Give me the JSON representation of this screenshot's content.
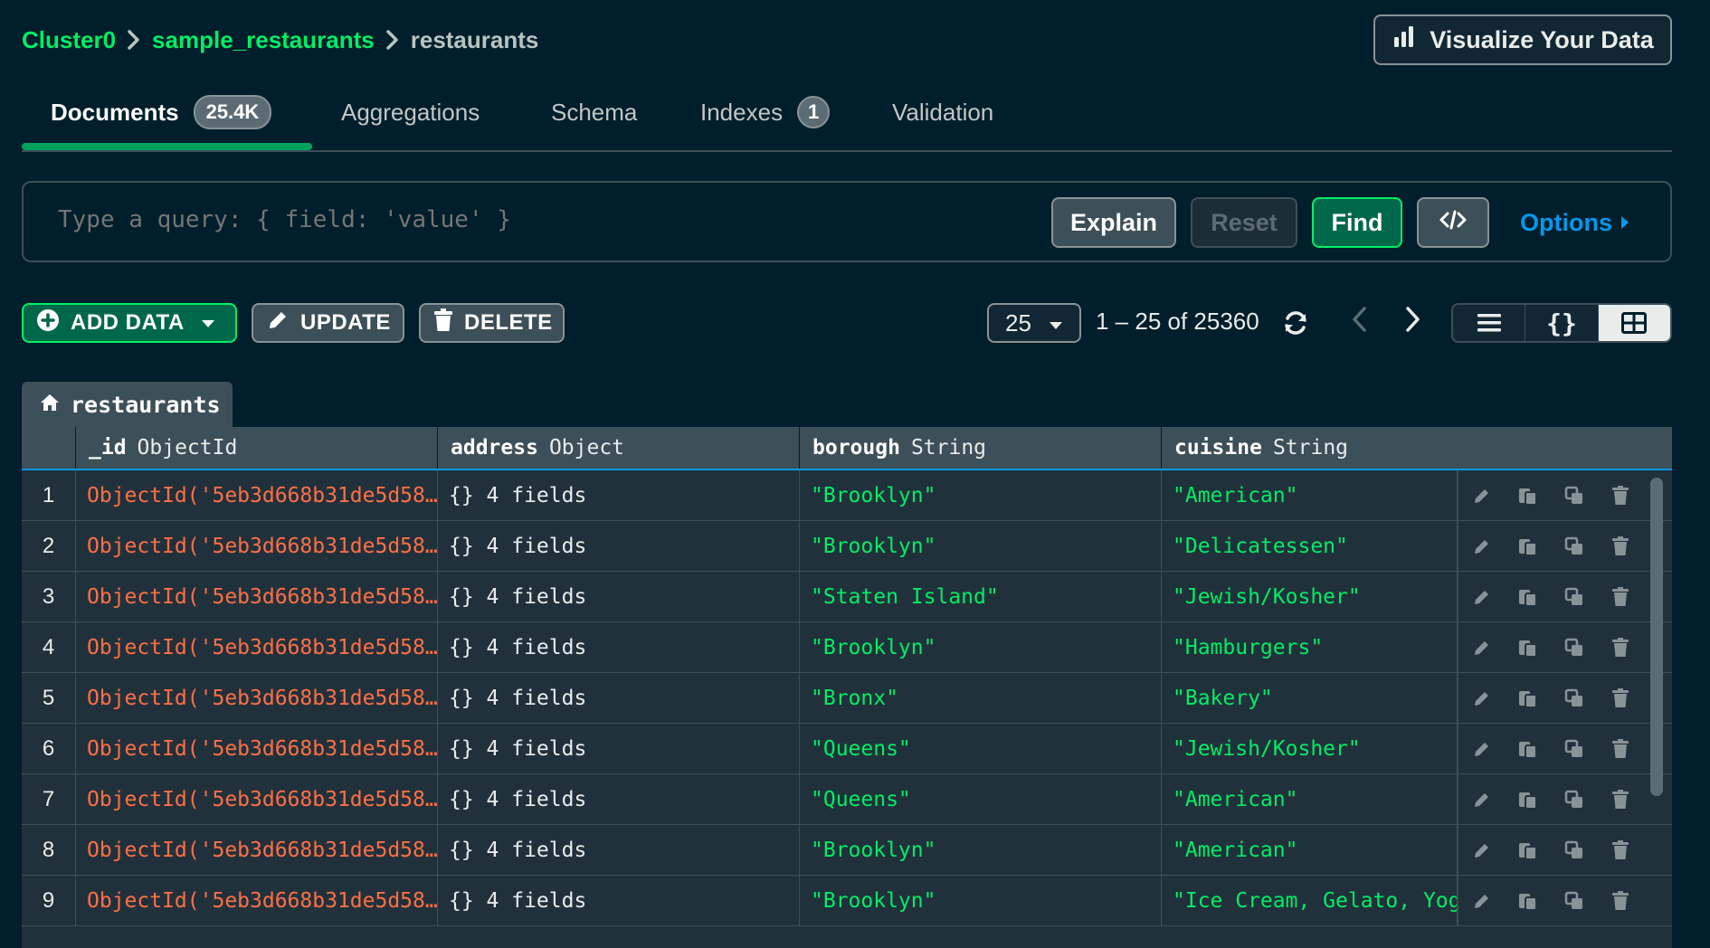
{
  "breadcrumb": {
    "cluster": "Cluster0",
    "database": "sample_restaurants",
    "collection": "restaurants"
  },
  "visualize_button": "Visualize Your Data",
  "tabs": [
    {
      "label": "Documents",
      "badge": "25.4K"
    },
    {
      "label": "Aggregations"
    },
    {
      "label": "Schema"
    },
    {
      "label": "Indexes",
      "badge": "1"
    },
    {
      "label": "Validation"
    }
  ],
  "query": {
    "placeholder": "Type a query: { field: 'value' }",
    "explain": "Explain",
    "reset": "Reset",
    "find": "Find",
    "options": "Options"
  },
  "toolbar": {
    "add_data": "ADD DATA",
    "update": "UPDATE",
    "delete": "DELETE",
    "page_size": "25",
    "range": "1 – 25 of 25360"
  },
  "table": {
    "collection_tab": "restaurants",
    "columns": [
      {
        "name": "_id",
        "type": "ObjectId"
      },
      {
        "name": "address",
        "type": "Object"
      },
      {
        "name": "borough",
        "type": "String"
      },
      {
        "name": "cuisine",
        "type": "String"
      }
    ],
    "rows": [
      {
        "n": "1",
        "id": "ObjectId('5eb3d668b31de5d58…",
        "address": "{} 4 fields",
        "borough": "\"Brooklyn\"",
        "cuisine": "\"American\""
      },
      {
        "n": "2",
        "id": "ObjectId('5eb3d668b31de5d58…",
        "address": "{} 4 fields",
        "borough": "\"Brooklyn\"",
        "cuisine": "\"Delicatessen\""
      },
      {
        "n": "3",
        "id": "ObjectId('5eb3d668b31de5d58…",
        "address": "{} 4 fields",
        "borough": "\"Staten Island\"",
        "cuisine": "\"Jewish/Kosher\""
      },
      {
        "n": "4",
        "id": "ObjectId('5eb3d668b31de5d58…",
        "address": "{} 4 fields",
        "borough": "\"Brooklyn\"",
        "cuisine": "\"Hamburgers\""
      },
      {
        "n": "5",
        "id": "ObjectId('5eb3d668b31de5d58…",
        "address": "{} 4 fields",
        "borough": "\"Bronx\"",
        "cuisine": "\"Bakery\""
      },
      {
        "n": "6",
        "id": "ObjectId('5eb3d668b31de5d58…",
        "address": "{} 4 fields",
        "borough": "\"Queens\"",
        "cuisine": "\"Jewish/Kosher\""
      },
      {
        "n": "7",
        "id": "ObjectId('5eb3d668b31de5d58…",
        "address": "{} 4 fields",
        "borough": "\"Queens\"",
        "cuisine": "\"American\""
      },
      {
        "n": "8",
        "id": "ObjectId('5eb3d668b31de5d58…",
        "address": "{} 4 fields",
        "borough": "\"Brooklyn\"",
        "cuisine": "\"American\""
      },
      {
        "n": "9",
        "id": "ObjectId('5eb3d668b31de5d58…",
        "address": "{} 4 fields",
        "borough": "\"Brooklyn\"",
        "cuisine": "\"Ice Cream, Gelato, Yogu"
      }
    ]
  },
  "colors": {
    "background": "#001e2b",
    "brand_green": "#00ed64",
    "objectid": "#ff6f44",
    "link_blue": "#0498ec"
  },
  "icons": [
    "chevron-right-icon",
    "bar-chart-icon",
    "code-icon",
    "caret-right-icon",
    "plus-circle-icon",
    "caret-down-icon",
    "pencil-icon",
    "trash-icon",
    "refresh-icon",
    "chevron-left-icon",
    "list-view-icon",
    "json-view-icon",
    "table-view-icon",
    "home-icon",
    "edit-icon",
    "clone-icon",
    "copy-icon"
  ]
}
